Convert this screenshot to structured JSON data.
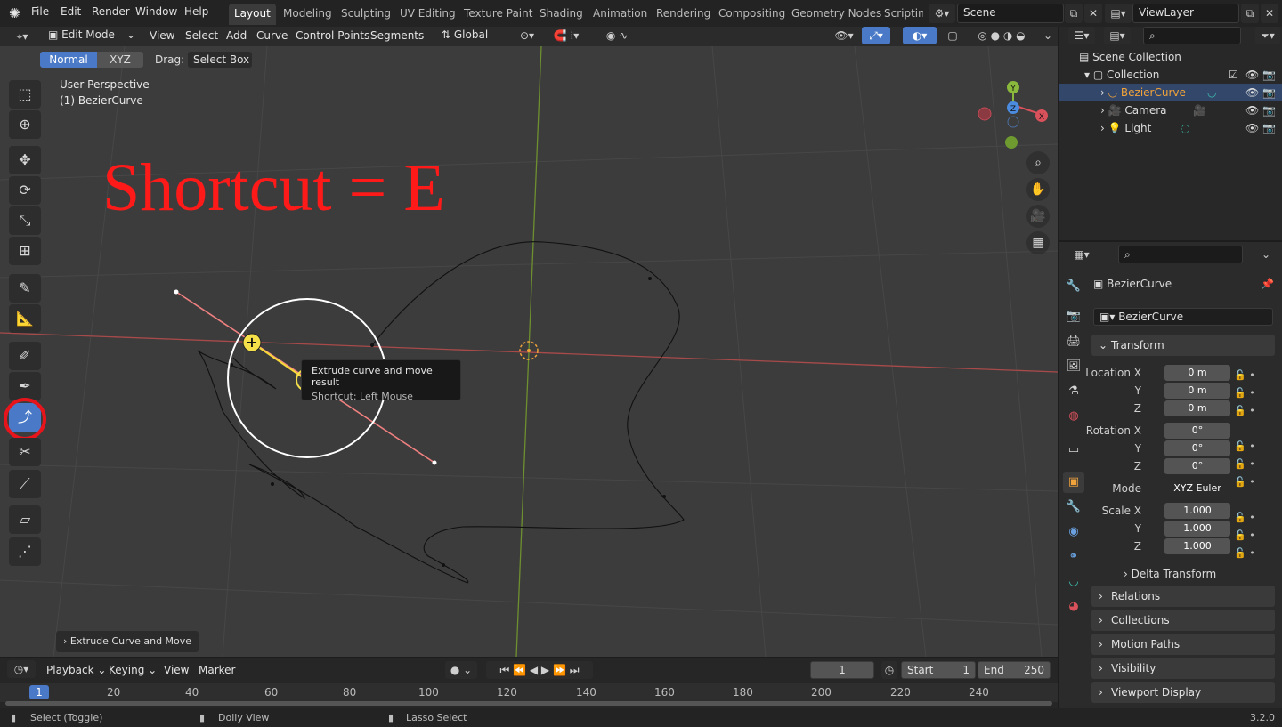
{
  "topbar": {
    "menus": [
      "File",
      "Edit",
      "Render",
      "Window",
      "Help"
    ],
    "workspaces": [
      "Layout",
      "Modeling",
      "Sculpting",
      "UV Editing",
      "Texture Paint",
      "Shading",
      "Animation",
      "Rendering",
      "Compositing",
      "Geometry Nodes",
      "Scripting"
    ],
    "active_workspace": "Layout",
    "scene": "Scene",
    "view_layer": "ViewLayer"
  },
  "viewport_header": {
    "mode": "Edit Mode",
    "menus": [
      "View",
      "Select",
      "Add",
      "Curve",
      "Control Points",
      "Segments"
    ],
    "orientation": "Global"
  },
  "tool_header": {
    "normal_label": "Normal",
    "xyz_label": "XYZ",
    "drag_label": "Drag:",
    "drag_value": "Select Box"
  },
  "viewport": {
    "perspective": "User Perspective",
    "object": "(1) BezierCurve",
    "annotation": "Shortcut = E",
    "tooltip_title": "Extrude curve and move result",
    "tooltip_shortcut": "Shortcut: Left Mouse",
    "last_op": "Extrude Curve and Move",
    "gizmo_y": "Y",
    "gizmo_z": "Z",
    "gizmo_x": "X"
  },
  "outliner": {
    "root": "Scene Collection",
    "collection": "Collection",
    "items": [
      "BezierCurve",
      "Camera",
      "Light"
    ]
  },
  "properties": {
    "object_name": "BezierCurve",
    "data_name": "BezierCurve",
    "transform_label": "Transform",
    "location_x_label": "Location X",
    "y_label": "Y",
    "z_label": "Z",
    "rotation_x_label": "Rotation X",
    "mode_label": "Mode",
    "mode_value": "XYZ Euler",
    "scale_x_label": "Scale X",
    "location": [
      "0 m",
      "0 m",
      "0 m"
    ],
    "rotation": [
      "0°",
      "0°",
      "0°"
    ],
    "scale": [
      "1.000",
      "1.000",
      "1.000"
    ],
    "panels": [
      "Delta Transform",
      "Relations",
      "Collections",
      "Motion Paths",
      "Visibility",
      "Viewport Display"
    ]
  },
  "timeline": {
    "menus": [
      "Playback",
      "Keying",
      "View",
      "Marker"
    ],
    "current_frame": "1",
    "start_label": "Start",
    "start_value": "1",
    "end_label": "End",
    "end_value": "250",
    "ruler": [
      "1",
      "20",
      "40",
      "60",
      "80",
      "100",
      "120",
      "140",
      "160",
      "180",
      "200",
      "220",
      "240"
    ]
  },
  "status": {
    "left": "Select (Toggle)",
    "middle": "Dolly View",
    "right": "Lasso Select",
    "version": "3.2.0"
  },
  "colors": {
    "accent": "#4a7ac7",
    "annotation": "#ff1a1a",
    "x_axis": "#e06a6a",
    "y_axis": "#8ab83c",
    "selection": "#f0a33a"
  }
}
